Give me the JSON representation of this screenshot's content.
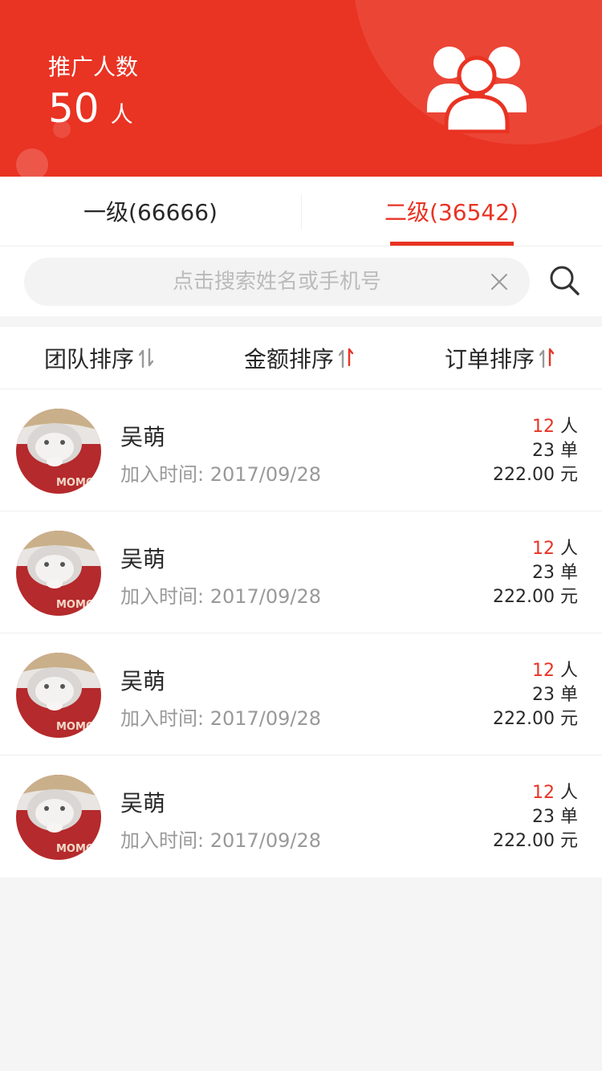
{
  "colors": {
    "accent": "#e93323",
    "text": "#282828",
    "muted": "#999999",
    "background": "#f5f5f5"
  },
  "header": {
    "label": "推广人数",
    "count": "50",
    "unit": "人",
    "icon": "group-icon"
  },
  "tabs": [
    {
      "label": "一级(66666)",
      "active": false
    },
    {
      "label": "二级(36542)",
      "active": true
    }
  ],
  "search": {
    "placeholder": "点击搜索姓名或手机号",
    "value": ""
  },
  "sort": [
    {
      "label": "团队排序",
      "icon": "sort-icon",
      "state": "none"
    },
    {
      "label": "金额排序",
      "icon": "sort-icon",
      "state": "up"
    },
    {
      "label": "订单排序",
      "icon": "sort-icon",
      "state": "up"
    }
  ],
  "members": [
    {
      "name": "吴萌",
      "join": "加入时间: 2017/09/28",
      "people": "12",
      "people_unit": "人",
      "orders": "23 单",
      "amount": "222.00 元"
    },
    {
      "name": "吴萌",
      "join": "加入时间: 2017/09/28",
      "people": "12",
      "people_unit": "人",
      "orders": "23 单",
      "amount": "222.00 元"
    },
    {
      "name": "吴萌",
      "join": "加入时间: 2017/09/28",
      "people": "12",
      "people_unit": "人",
      "orders": "23 单",
      "amount": "222.00 元"
    },
    {
      "name": "吴萌",
      "join": "加入时间: 2017/09/28",
      "people": "12",
      "people_unit": "人",
      "orders": "23 单",
      "amount": "222.00 元"
    }
  ],
  "avatar_text": "MOMO"
}
